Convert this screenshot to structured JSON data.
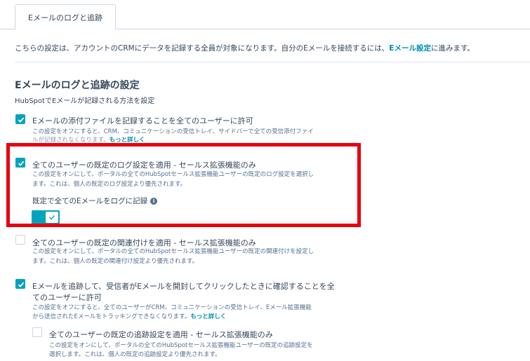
{
  "tabs": {
    "active": "Eメールのログと追跡"
  },
  "intro": {
    "text": "こちらの設定は、アカウントのCRMにデータを記録する全員が対象になります。自分のEメールを接続するには、",
    "link": "Eメール設定",
    "suffix": "に進みます。"
  },
  "section": {
    "title": "Eメールのログと追跡の設定",
    "subtitle": "HubSpotでEメールが記録される方法を設定"
  },
  "options": [
    {
      "label": "Eメールの添付ファイルを記録することを全てのユーザーに許可",
      "checked": true,
      "desc_line1": "この設定をオフにすると、CRM、コミュニケーションの受信トレイ、サイドバーで全ての受信添付ファイ",
      "desc_line2": "ルが記録されなくなります。",
      "more": "もっと詳しく"
    },
    {
      "label": "全てのユーザーの既定のログ設定を適用 - セールス拡張機能のみ",
      "checked": true,
      "desc_line1": "この設定をオンにして、ポータルの全てのHubSpotセールス拡張機能ユーザーの既定のログ設定を選択し",
      "desc_line2": "ます。これは、個人の既定のログ設定より優先されます。"
    },
    {
      "label": "全てのユーザーの既定の関連付けを適用 - セールス拡張機能のみ",
      "checked": false,
      "desc_line1": "この設定をオンにして、ポータルの全てのHubSpotセールス拡張機能ユーザーの既定の関連付けを設定し",
      "desc_line2": "ます。これは、個人の既定の関連付け設定より優先されます。"
    },
    {
      "label_line1": "Eメールを追跡して、受信者がEメールを開封してクリックしたときに確認することを全",
      "label_line2": "てのユーザーに許可",
      "checked": true,
      "desc_line1": "この設定をオフにすると、全てのユーザーがCRM、コミュニケーションの受信トレイ、Eメール拡張機能",
      "desc_line2": "から送信されたEメールをトラッキングできなくなります。",
      "more": "もっと詳しく"
    },
    {
      "label": "全てのユーザーの既定の追跡設定を適用 - セールス拡張機能のみ",
      "checked": false,
      "desc_line1": "この設定をオンにして、ポータルの全てのHubSpotセールス拡張機能ユーザーの既定の追跡設定を",
      "desc_line2": "選択します。これは、個人の既定の追跡設定より優先されます。"
    }
  ],
  "default_log": {
    "label": "既定で全てのEメールをログに記録",
    "info_glyph": "i",
    "enabled": true
  },
  "colors": {
    "accent": "#00a4bd",
    "link": "#0091ae",
    "highlight": "#e8000f",
    "text": "#33475b"
  }
}
